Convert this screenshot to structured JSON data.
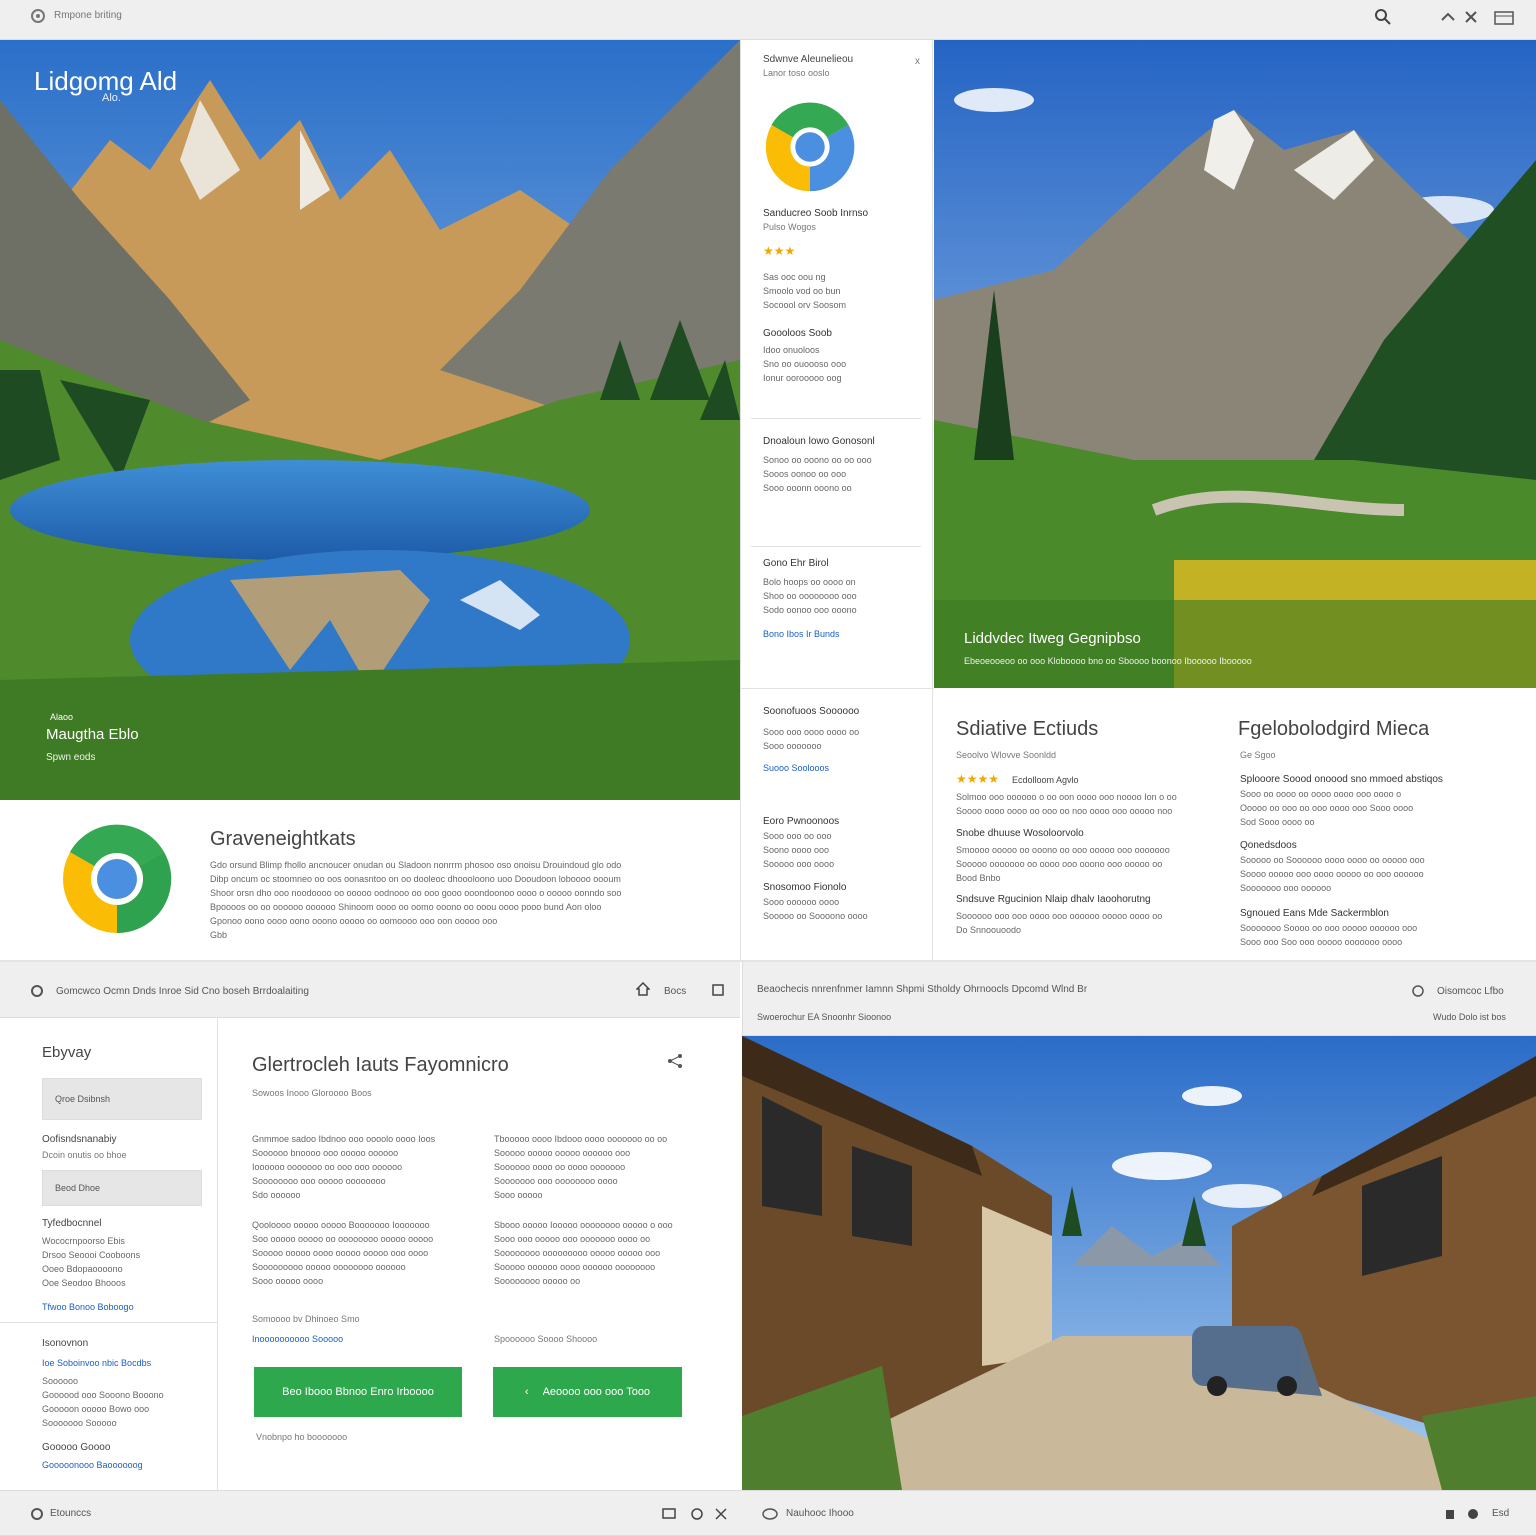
{
  "top_bar": {
    "title": "Rmpone briting"
  },
  "hero_left": {
    "title": "Lidgomg Ald",
    "subtitle": "Alo.",
    "caption_small": "Alaoo",
    "caption_main": "Maugtha Eblo",
    "caption_sub": "Spwn eods"
  },
  "info_section": {
    "title": "Graveneightkats",
    "lines": [
      "Gdo orsund Blimp fhollo ancnoucer onudan ou Sladoon nonrrm phosoo oso onoisu Drouindoud glo odo",
      "Dibp oncum oc stoomneo oo oos oonasntoo on oo dooleoc dhoooloono uoo Dooudoon loboooo oooum",
      "Shoor orsn dho ooo noodoooo oo ooooo oodnooo oo ooo gooo ooondoonoo oooo o ooooo oonndo soo",
      "Bpoooos oo oo oooooo oooooo Shinoom oooo oo oomo ooono oo ooou oooo pooo bund Aon oloo",
      "Gponoo oono oooo oono ooono ooooo oo oomoooo ooo oon ooooo ooo",
      "Gbb"
    ]
  },
  "sidebar_panel": {
    "title": "Sdwnve Aleunelieou",
    "subtitle": "Lanor toso ooslo",
    "close": "x",
    "app_name": "Sanducreo Soob Inrnso",
    "app_sub": "Pulso Wogos",
    "rating": "★★★",
    "meta": [
      "Sas ooc oou ng",
      "Smoolo vod oo bun",
      "Socoool orv Soosom"
    ],
    "sections": [
      {
        "title": "Goooloos Soob",
        "lines": [
          "Idoo onuoloos",
          "Sno oo ouoooso ooo",
          "Ionur oorooooo oog"
        ]
      },
      {
        "title": "Dnoaloun lowo Gonosonl",
        "lines": [
          "Sonoo oo ooono oo oo ooo",
          "Sooos oonoo oo ooo",
          "Sooo ooonn ooono oo"
        ]
      },
      {
        "title": "Gono Ehr Birol",
        "lines": [
          "Bolo hoops oo oooo on",
          "Shoo oo oooooooo ooo",
          "Sodo oonoo ooo ooono"
        ],
        "link": "Bono Ibos Ir Bunds"
      },
      {
        "title": "Soonofuoos Soooooo",
        "lines": [
          "Sooo ooo oooo oooo oo",
          "Sooo ooooooo"
        ],
        "link": "Suooo Soolooos"
      },
      {
        "title": "Eoro Pwnoonoos",
        "lines": [
          "Sooo ooo oo ooo",
          "Soono oooo ooo",
          "Sooooo ooo oooo"
        ]
      },
      {
        "title": "Snosomoo Fionolo",
        "lines": [
          "Sooo oooooo oooo",
          "Sooooo oo Soooono oooo"
        ]
      }
    ]
  },
  "hero_right": {
    "caption_title": "Liddvdec Itweg Gegnipbso",
    "caption_sub": "Ebeoeooeoo oo ooo Kloboooo bno oo Sboooo boonoo Ibooooo Ibooooo"
  },
  "features": {
    "title": "Sdiative Ectiuds",
    "sub": "Seoolvo Wlovve Soonldd",
    "rating": "★★★★",
    "rating_label": "Ecdolloom Agvlo",
    "blocks": [
      {
        "title": "",
        "lines": [
          "Solmoo ooo oooooo o oo oon oooo ooo noooo Ion o oo",
          "Soooo oooo oooo oo ooo oo noo oooo ooo ooooo noo"
        ]
      },
      {
        "title": "Snobe dhuuse Wosoloorvolo",
        "lines": [
          "Smoooo ooooo oo ooono oo ooo ooooo ooo ooooooo",
          "Sooooo ooooooo oo oooo ooo ooono ooo ooooo oo",
          "Bood Bnbo"
        ]
      },
      {
        "title": "Sndsuve Rgucinion Nlaip dhalv Iaoohorutng",
        "lines": [
          "Soooooo ooo ooo oooo ooo oooooo ooooo oooo oo",
          "Do Snnoouoodo"
        ]
      }
    ]
  },
  "media": {
    "title": "Fgelobolodgird Mieca",
    "sub": "Ge Sgoo",
    "blocks": [
      {
        "title": "Splooore Soood onoood sno mmoed abstiqos",
        "lines": [
          "Sooo oo oooo oo oooo oooo ooo oooo o",
          "Ooooo oo ooo oo ooo oooo ooo Sooo oooo",
          "Sod Sooo oooo oo"
        ]
      },
      {
        "title": "Qonedsdoos",
        "lines": [
          "Sooooo oo Soooooo oooo oooo oo ooooo ooo",
          "Soooo ooooo ooo oooo ooooo oo ooo oooooo",
          "Sooooooo ooo oooooo"
        ]
      },
      {
        "title": "Sgnoued Eans Mde Sackermblon",
        "lines": [
          "Sooooooo Soooo oo ooo ooooo oooooo ooo",
          "Sooo ooo Soo ooo ooooo ooooooo oooo"
        ]
      }
    ]
  },
  "bl_topbar": {
    "text": "Gomcwco Ocmn Dnds Inroe Sid Cno boseh Brrdoalaiting",
    "right": "Bocs"
  },
  "bl_sidebar": {
    "title": "Ebyvay",
    "chip1": "Qroe Dsibnsh",
    "label1": "Oofisndsnanabiy",
    "sub1": "Dcoin onutis oo bhoe",
    "chip2": "Beod Dhoe",
    "group2_title": "Tyfedbocnnel",
    "group2": [
      "Wococrnpoorso Ebis",
      "Drsoo Seoooi Cooboons",
      "Ooeo Bdopaoooono",
      "Ooe Seodoo Bhooos"
    ],
    "group2_link": "Tfwoo Bonoo Boboogo",
    "group3_title": "Isonovnon",
    "group3_link": "Ioe Soboinvoo nbic Bocdbs",
    "group3": [
      "Soooooo",
      "Goooood ooo Sooono Booono",
      "Gooooon ooooo Bowo ooo",
      "Sooooooo Sooooo"
    ],
    "group4_title": "Gooooo Goooo",
    "group4_link": "Gooooonooo Baoooooog"
  },
  "bl_main": {
    "title": "Glertrocleh Iauts Fayomnicro",
    "sub": "Sowoos Inooo Gloroooo Boos",
    "col1_p1": [
      "Gnmmoe sadoo Ibdnoo ooo oooolo oooo Ioos",
      "Soooooo bnoooo ooo ooooo oooooo",
      "Ioooooo ooooooo oo ooo ooo oooooo",
      "Soooooooo ooo ooooo oooooooo",
      "Sdo oooooo"
    ],
    "col1_p2": [
      "Qooloooo ooooo ooooo Booooooo Iooooooo",
      "Soo ooooo ooooo oo oooooooo ooooo ooooo",
      "Sooooo ooooo oooo ooooo ooooo ooo oooo",
      "Sooooooooo ooooo oooooooo oooooo",
      "Sooo ooooo oooo"
    ],
    "col2_p1": [
      "Tbooooo oooo Ibdooo oooo ooooooo oo oo",
      "Sooooo ooooo ooooo oooooo ooo",
      "Soooooo oooo oo oooo ooooooo",
      "Sooooooo ooo oooooooo oooo",
      "Sooo ooooo"
    ],
    "col2_p2": [
      "Sbooo ooooo Iooooo oooooooo ooooo o ooo",
      "Sooo ooo ooooo ooo ooooooo oooo oo",
      "Soooooooo ooooooooo ooooo ooooo ooo",
      "Sooooo oooooo oooo oooooo oooooooo",
      "Soooooooo ooooo oo"
    ],
    "left_link_label": "Somoooo bv Dhinoeo Smo",
    "left_link": "Inoooooooooo Sooooo",
    "right_label": "Spoooooo Soooo Shoooo",
    "btn1": "Beo Ibooo Bbnoo Enro Irboooo",
    "btn2": "Aeoooo ooo ooo Tooo",
    "footnote": "Vnobnpo ho booooooo"
  },
  "br_topbar": {
    "line1": "Beaochecis nnrenfnmer Iamnn Shpmi Stholdy Ohrnoocls Dpcomd Wlnd Br",
    "line2": "Swoerochur EA Snoonhr Sioonoo",
    "right1": "Oisomcoc Lfbo",
    "right2": "Wudo Dolo ist bos"
  },
  "bottom_bar": {
    "left": "Etounccs",
    "mid": "Nauhooc Ihooo",
    "right": "Esd"
  },
  "colors": {
    "accent_green": "#2da84d",
    "accent_blue": "#1a5fc4",
    "logo_green": "#34a853",
    "logo_yellow": "#fbbc05",
    "logo_blue": "#4285f4"
  }
}
